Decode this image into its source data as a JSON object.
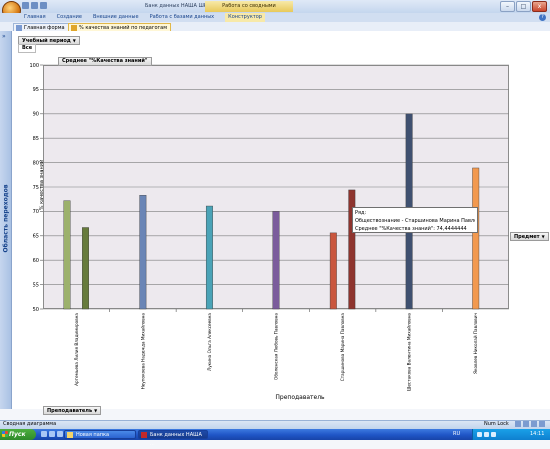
{
  "window": {
    "title": "Банк данных НАША ШКОЛА",
    "context_title": "Работа со сводными диаграммами",
    "min_glyph": "–",
    "max_glyph": "□",
    "close_glyph": "x"
  },
  "ribbon": {
    "tabs": [
      "Главная",
      "Создание",
      "Внешние данные",
      "Работа с базами данных",
      "Конструктор"
    ],
    "help_glyph": "?"
  },
  "doc_tabs": [
    "Главная форма",
    "% качества знаний по педагогам"
  ],
  "nav_pane": {
    "label": "Область переходов",
    "arrow": "»"
  },
  "filter": {
    "label": "Учебный период",
    "value": "Все"
  },
  "measure_button": "Среднее \"%Качества знаний\"",
  "series_button": "Предмет",
  "category_button": "Преподаватель",
  "tooltip": {
    "line1": "Ряд:",
    "line2": "Обществознание - Старшинова Марина Павловна",
    "line3": "Среднее \"%Качества знаний\": 74,4444444"
  },
  "status": {
    "left": "Сводная диаграмма",
    "num_lock": "Num Lock"
  },
  "taskbar": {
    "start": "Пуск",
    "tasks": [
      "Новая папка",
      "Банк данных НАША ..."
    ],
    "lang": "RU",
    "clock": "14:11"
  },
  "chart_data": {
    "type": "bar",
    "title": "",
    "ylabel": "% качества знаний",
    "xlabel": "Преподаватель",
    "ylim": [
      50,
      100
    ],
    "yticks": [
      50,
      55,
      60,
      65,
      70,
      75,
      80,
      85,
      90,
      95,
      100
    ],
    "grid": true,
    "categories": [
      "Артемьева Лилия Владимировна",
      "Неупокоева Надежда Михайловна",
      "Лукина Ольга Алексеевна",
      "Оболенская Любовь Павловна",
      "Старшинова Марина Павловна",
      "Шестакова Валентина Михайловна",
      "Яковлев Николай Павлович"
    ],
    "bars": [
      {
        "category": 0,
        "value": 72.2,
        "color": "#9cb16c"
      },
      {
        "category": 0,
        "value": 66.7,
        "color": "#677b3c"
      },
      {
        "category": 1,
        "value": 73.3,
        "color": "#6a85b6"
      },
      {
        "category": 2,
        "value": 71.1,
        "color": "#4aa3b7"
      },
      {
        "category": 3,
        "value": 70.0,
        "color": "#7b5c9c"
      },
      {
        "category": 4,
        "value": 65.6,
        "color": "#c9563e"
      },
      {
        "category": 4,
        "value": 74.4,
        "color": "#8e342e"
      },
      {
        "category": 5,
        "value": 90.0,
        "color": "#3f5070"
      },
      {
        "category": 6,
        "value": 78.9,
        "color": "#f2994f"
      }
    ]
  }
}
